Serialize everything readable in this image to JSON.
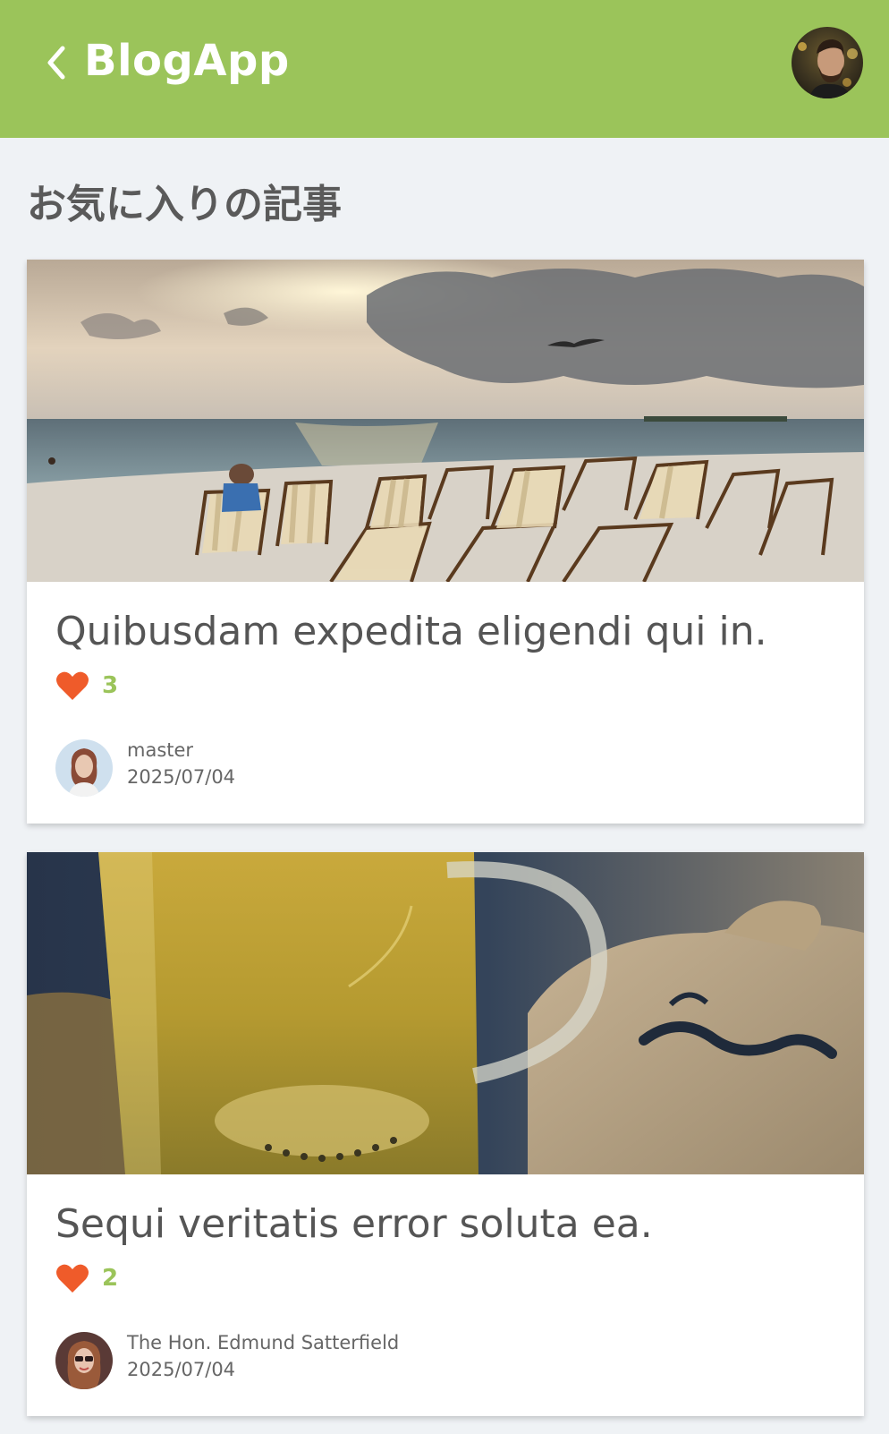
{
  "app": {
    "title": "BlogApp",
    "header_color": "#9bc45a"
  },
  "page": {
    "heading": "お気に入りの記事"
  },
  "icons": {
    "back": "chevron-left-icon",
    "like": "heart-icon"
  },
  "articles": [
    {
      "title": "Quibusdam expedita eligendi qui in.",
      "likes": "3",
      "author": "master",
      "date": "2025/07/04",
      "image": "beach-with-deck-chairs-at-sunset"
    },
    {
      "title": "Sequi veritatis error soluta ea.",
      "likes": "2",
      "author": "The Hon. Edmund Satterfield",
      "date": "2025/07/04",
      "image": "glass-mug-of-tea-with-burlap-tea-bag"
    }
  ]
}
